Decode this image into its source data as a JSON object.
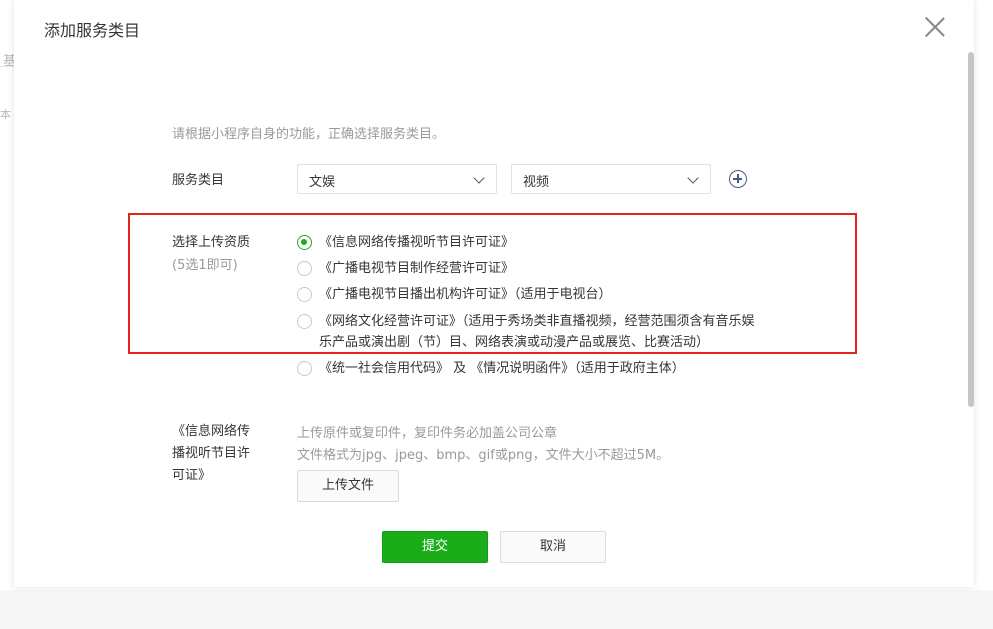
{
  "background": {
    "frag_1": "基",
    "frag_2": "本"
  },
  "dialog": {
    "title": "添加服务类目",
    "tip": "请根据小程序自身的功能，正确选择服务类目。",
    "category": {
      "label": "服务类目",
      "first_select": "文娱",
      "second_select": "视频"
    },
    "qualification": {
      "label": "选择上传资质",
      "sublabel": "(5选1即可)",
      "options": [
        {
          "label": "《信息网络传播视听节目许可证》",
          "checked": true
        },
        {
          "label": "《广播电视节目制作经营许可证》",
          "checked": false
        },
        {
          "label": "《广播电视节目播出机构许可证》（适用于电视台）",
          "checked": false
        },
        {
          "label": "《网络文化经营许可证》（适用于秀场类非直播视频，经营范围须含有音乐娱",
          "label_line2": "乐产品或演出剧（节）目、网络表演或动漫产品或展览、比赛活动）",
          "checked": false
        },
        {
          "label": "《统一社会信用代码》 及 《情况说明函件》（适用于政府主体）",
          "checked": false
        }
      ]
    },
    "upload": {
      "label_line1": "《信息网络传",
      "label_line2": "播视听节目许",
      "label_line3": "可证》",
      "note_line1": "上传原件或复印件，复印件务必加盖公司公章",
      "note_line2": "文件格式为jpg、jpeg、bmp、gif或png，文件大小不超过5M。",
      "button": "上传文件"
    },
    "submit": "提交",
    "cancel": "取消"
  },
  "colors": {
    "primary_green": "#1aad19",
    "highlight_red": "#e1251b"
  }
}
